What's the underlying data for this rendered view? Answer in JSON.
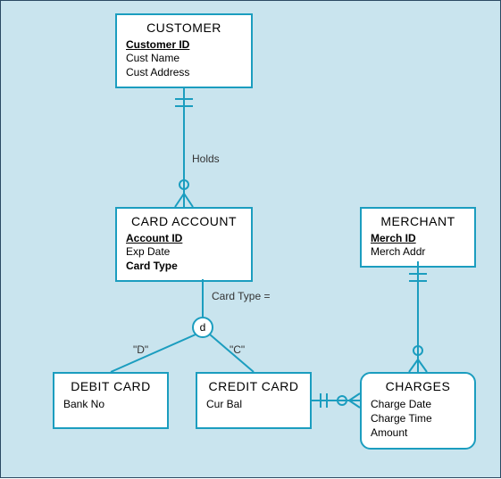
{
  "entities": {
    "customer": {
      "title": "CUSTOMER",
      "key": "Customer ID",
      "attrs": [
        "Cust Name",
        "Cust Address"
      ]
    },
    "card_account": {
      "title": "CARD ACCOUNT",
      "key": "Account ID",
      "attr_plain": "Exp Date",
      "attr_bold": "Card Type"
    },
    "merchant": {
      "title": "MERCHANT",
      "key": "Merch ID",
      "attrs": [
        "Merch Addr"
      ]
    },
    "debit_card": {
      "title": "DEBIT CARD",
      "attrs": [
        "Bank No"
      ]
    },
    "credit_card": {
      "title": "CREDIT CARD",
      "attrs": [
        "Cur Bal"
      ]
    },
    "charges": {
      "title": "CHARGES",
      "attrs": [
        "Charge Date",
        "Charge Time",
        "Amount"
      ]
    }
  },
  "labels": {
    "holds": "Holds",
    "card_type_eq": "Card Type =",
    "disc": "d",
    "D": "\"D\"",
    "C": "\"C\""
  },
  "colors": {
    "line": "#1b9dbf",
    "bg": "#c9e4ee"
  }
}
